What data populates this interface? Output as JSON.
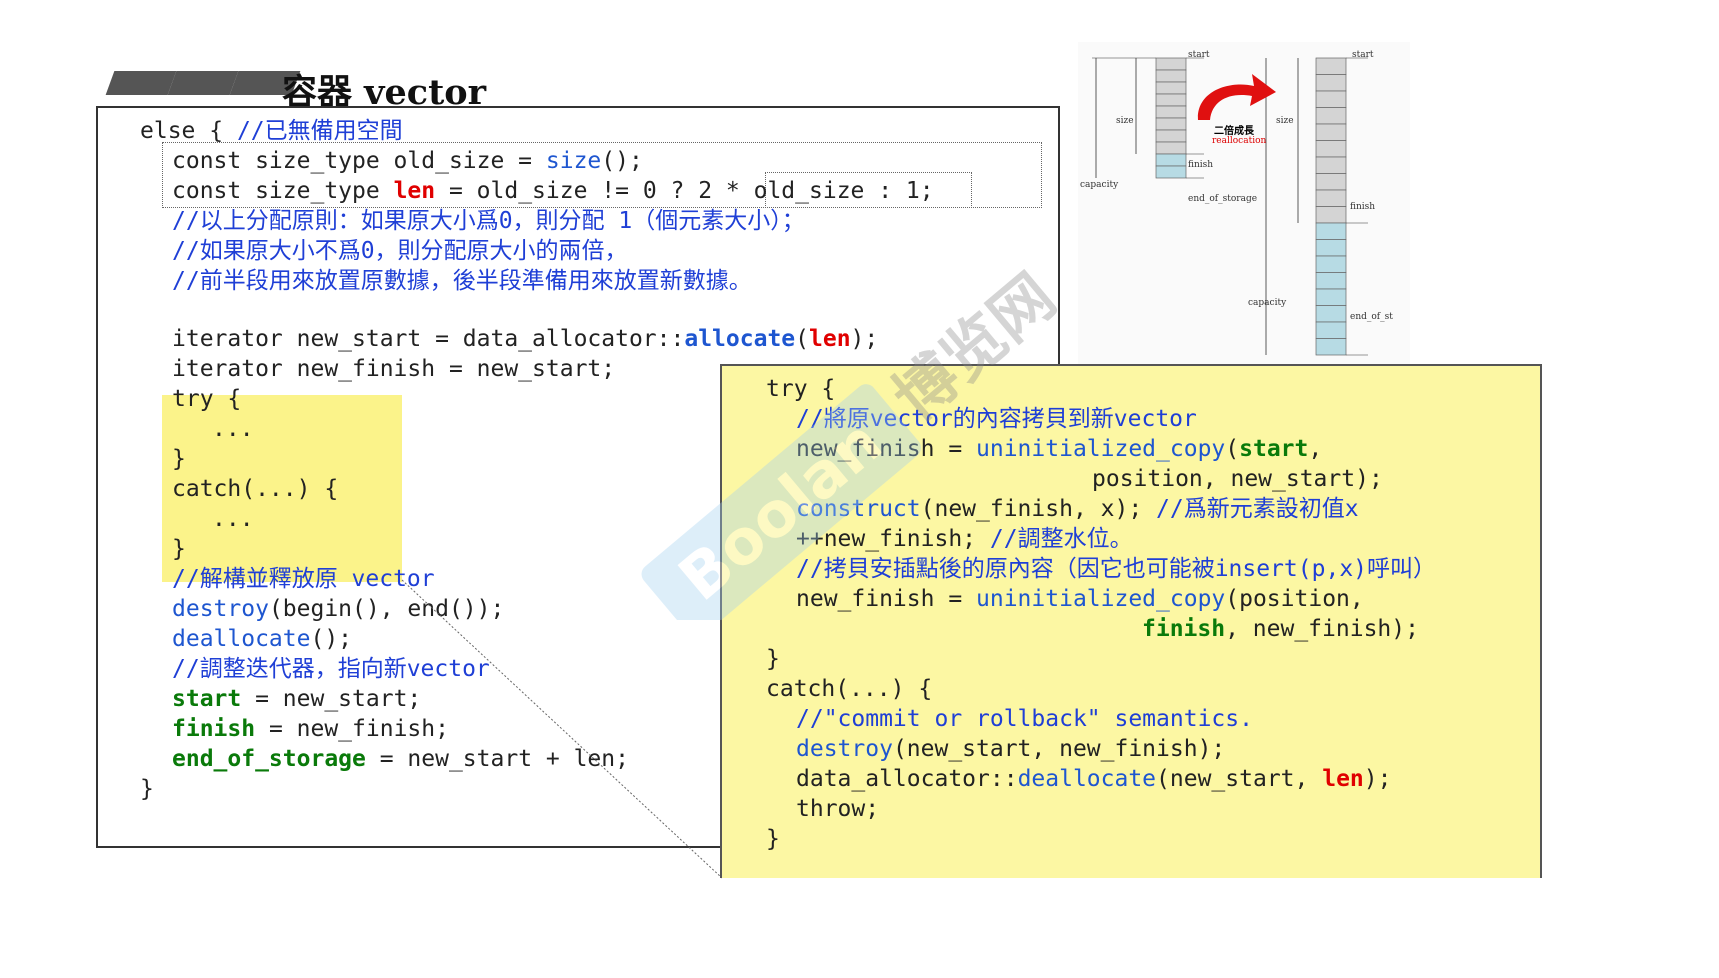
{
  "title": "容器 vector",
  "code_main": {
    "l1": "else {",
    "l1c": "//已無備用空間",
    "l2a": "const size_type old_size = ",
    "l2b": "size",
    "l2c": "();",
    "l3a": "const size_type ",
    "l3b": "len",
    "l3c": " = old_size != 0 ? ",
    "l3d": "2 * old_size",
    "l3e": " : 1;",
    "c1": "//以上分配原則：如果原大小爲0，則分配 1（個元素大小）；",
    "c2": "//如果原大小不爲0，則分配原大小的兩倍，",
    "c3": "//前半段用來放置原數據，後半段準備用來放置新數據。",
    "l4a": "iterator new_start = data_allocator::",
    "l4b": "allocate",
    "l4c": "(",
    "l4d": "len",
    "l4e": ");",
    "l5": "iterator new_finish = new_start;",
    "l6": "try {",
    "l7": "...",
    "l8": "}",
    "l9": "catch(...) {",
    "l10": "...",
    "l11": "}",
    "c4": "//解構並釋放原 vector",
    "l12a": "destroy",
    "l12b": "(begin(), end());",
    "l13a": "deallocate",
    "l13b": "();",
    "c5": "//調整迭代器，指向新vector",
    "l14a": "start",
    "l14b": " = new_start;",
    "l15a": "finish",
    "l15b": " = new_finish;",
    "l16a": "end_of_storage",
    "l16b": " = new_start + len;",
    "l17": "}"
  },
  "code_detail": {
    "d1": "try {",
    "d2": "//將原vector的內容拷貝到新vector",
    "d3a": "new_finish = ",
    "d3b": "uninitialized_copy",
    "d3c": "(",
    "d3d": "start",
    "d3e": ",",
    "d4": "position, new_start);",
    "d5a": "construct",
    "d5b": "(new_finish, x); ",
    "d5c": "//爲新元素設初值x",
    "d6a": "++new_finish; ",
    "d6b": "//調整水位。",
    "d7": "//拷貝安插點後的原內容（因它也可能被insert(p,x)呼叫）",
    "d8a": "new_finish = ",
    "d8b": "uninitialized_copy",
    "d8c": "(position,",
    "d9a": "finish",
    "d9b": ", new_finish);",
    "d10": "}",
    "d11": "catch(...) {",
    "d12": "//\"commit or rollback\" semantics.",
    "d13a": "destroy",
    "d13b": "(new_start, new_finish);",
    "d14a": "data_allocator::",
    "d14b": "deallocate",
    "d14c": "(new_start, ",
    "d14d": "len",
    "d14e": ");",
    "d15": "throw;",
    "d16": "}"
  },
  "diagram": {
    "left": {
      "start": "start",
      "size": "size",
      "capacity": "capacity",
      "finish": "finish",
      "end": "end_of_storage",
      "used_cells": 8,
      "spare_cells": 2
    },
    "arrow_label": "二倍成長",
    "arrow_sub": "reallocation",
    "right": {
      "start": "start",
      "size": "size",
      "capacity": "capacity",
      "finish": "finish",
      "end": "end_of_st",
      "used_cells": 10,
      "spare_cells": 8
    }
  },
  "colors": {
    "comment": "#1f3fd6",
    "keyword": "#1e56d0",
    "len": "#e00000",
    "member": "#0a7a0a",
    "highlight": "#fbf38a",
    "cell_used": "#d4d4d4",
    "cell_spare": "#b7dbe4"
  }
}
